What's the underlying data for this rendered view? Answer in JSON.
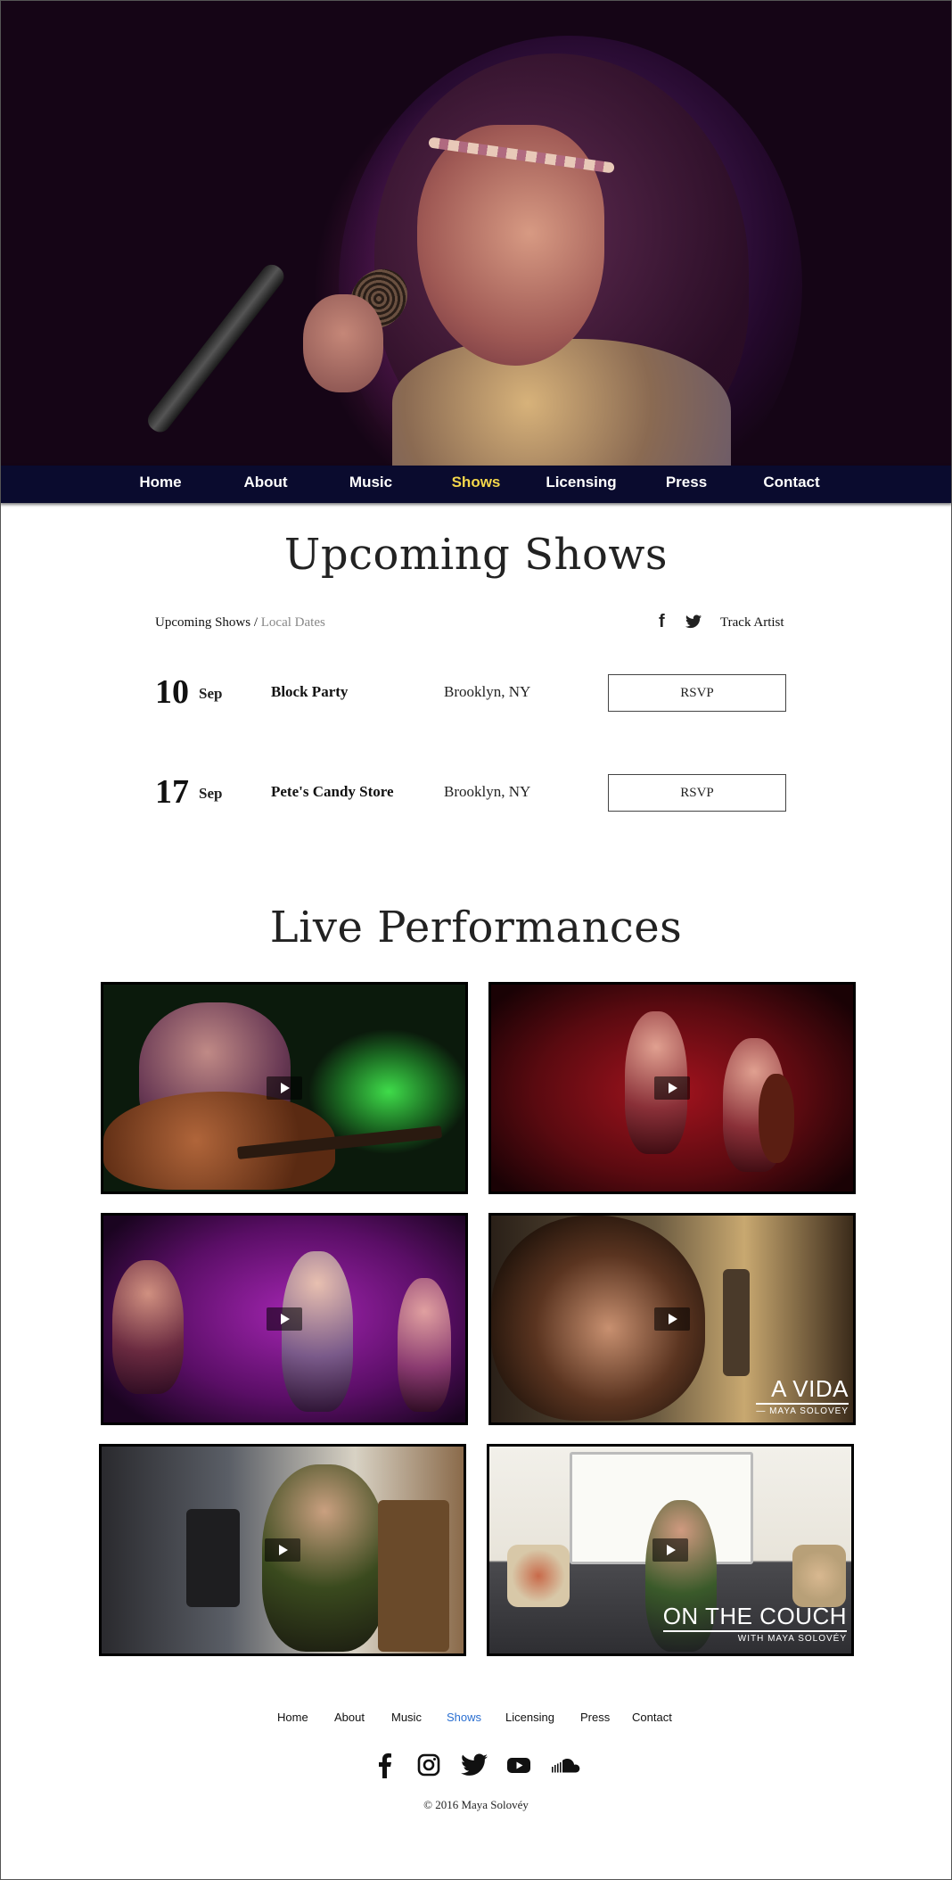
{
  "nav": {
    "items": [
      {
        "label": "Home"
      },
      {
        "label": "About"
      },
      {
        "label": "Music"
      },
      {
        "label": "Shows",
        "active": true
      },
      {
        "label": "Licensing"
      },
      {
        "label": "Press"
      },
      {
        "label": "Contact"
      }
    ],
    "colors": {
      "background": "#0a0b2e",
      "text": "#ffffff",
      "active": "#f3d64b"
    }
  },
  "upcoming": {
    "title": "Upcoming Shows",
    "breadcrumb": {
      "root": "Upcoming Shows",
      "separator": " / ",
      "current": "Local Dates"
    },
    "share_icons": [
      "facebook-icon",
      "twitter-icon"
    ],
    "track_label": "Track Artist",
    "shows": [
      {
        "day": "10",
        "month": "Sep",
        "venue": "Block Party",
        "location": "Brooklyn, NY",
        "button": "RSVP"
      },
      {
        "day": "17",
        "month": "Sep",
        "venue": "Pete's Candy Store",
        "location": "Brooklyn, NY",
        "button": "RSVP"
      }
    ]
  },
  "performances": {
    "title": "Live Performances",
    "videos": [
      {
        "overlay_title": "",
        "overlay_subtitle": ""
      },
      {
        "overlay_title": "",
        "overlay_subtitle": ""
      },
      {
        "overlay_title": "",
        "overlay_subtitle": ""
      },
      {
        "overlay_title": "A VIDA",
        "overlay_subtitle": "— MAYA SOLOVEY"
      },
      {
        "overlay_title": "",
        "overlay_subtitle": ""
      },
      {
        "overlay_title": "ON THE COUCH",
        "overlay_subtitle": "WITH MAYA SOLOVÉY"
      }
    ]
  },
  "footer": {
    "nav": [
      {
        "label": "Home"
      },
      {
        "label": "About"
      },
      {
        "label": "Music"
      },
      {
        "label": "Shows",
        "active": true
      },
      {
        "label": "Licensing"
      },
      {
        "label": "Press"
      },
      {
        "label": "Contact"
      }
    ],
    "social": [
      "facebook-icon",
      "instagram-icon",
      "twitter-icon",
      "youtube-icon",
      "soundcloud-icon"
    ],
    "copyright": "© 2016 Maya Solovéy",
    "active_color": "#2a6fd1"
  }
}
